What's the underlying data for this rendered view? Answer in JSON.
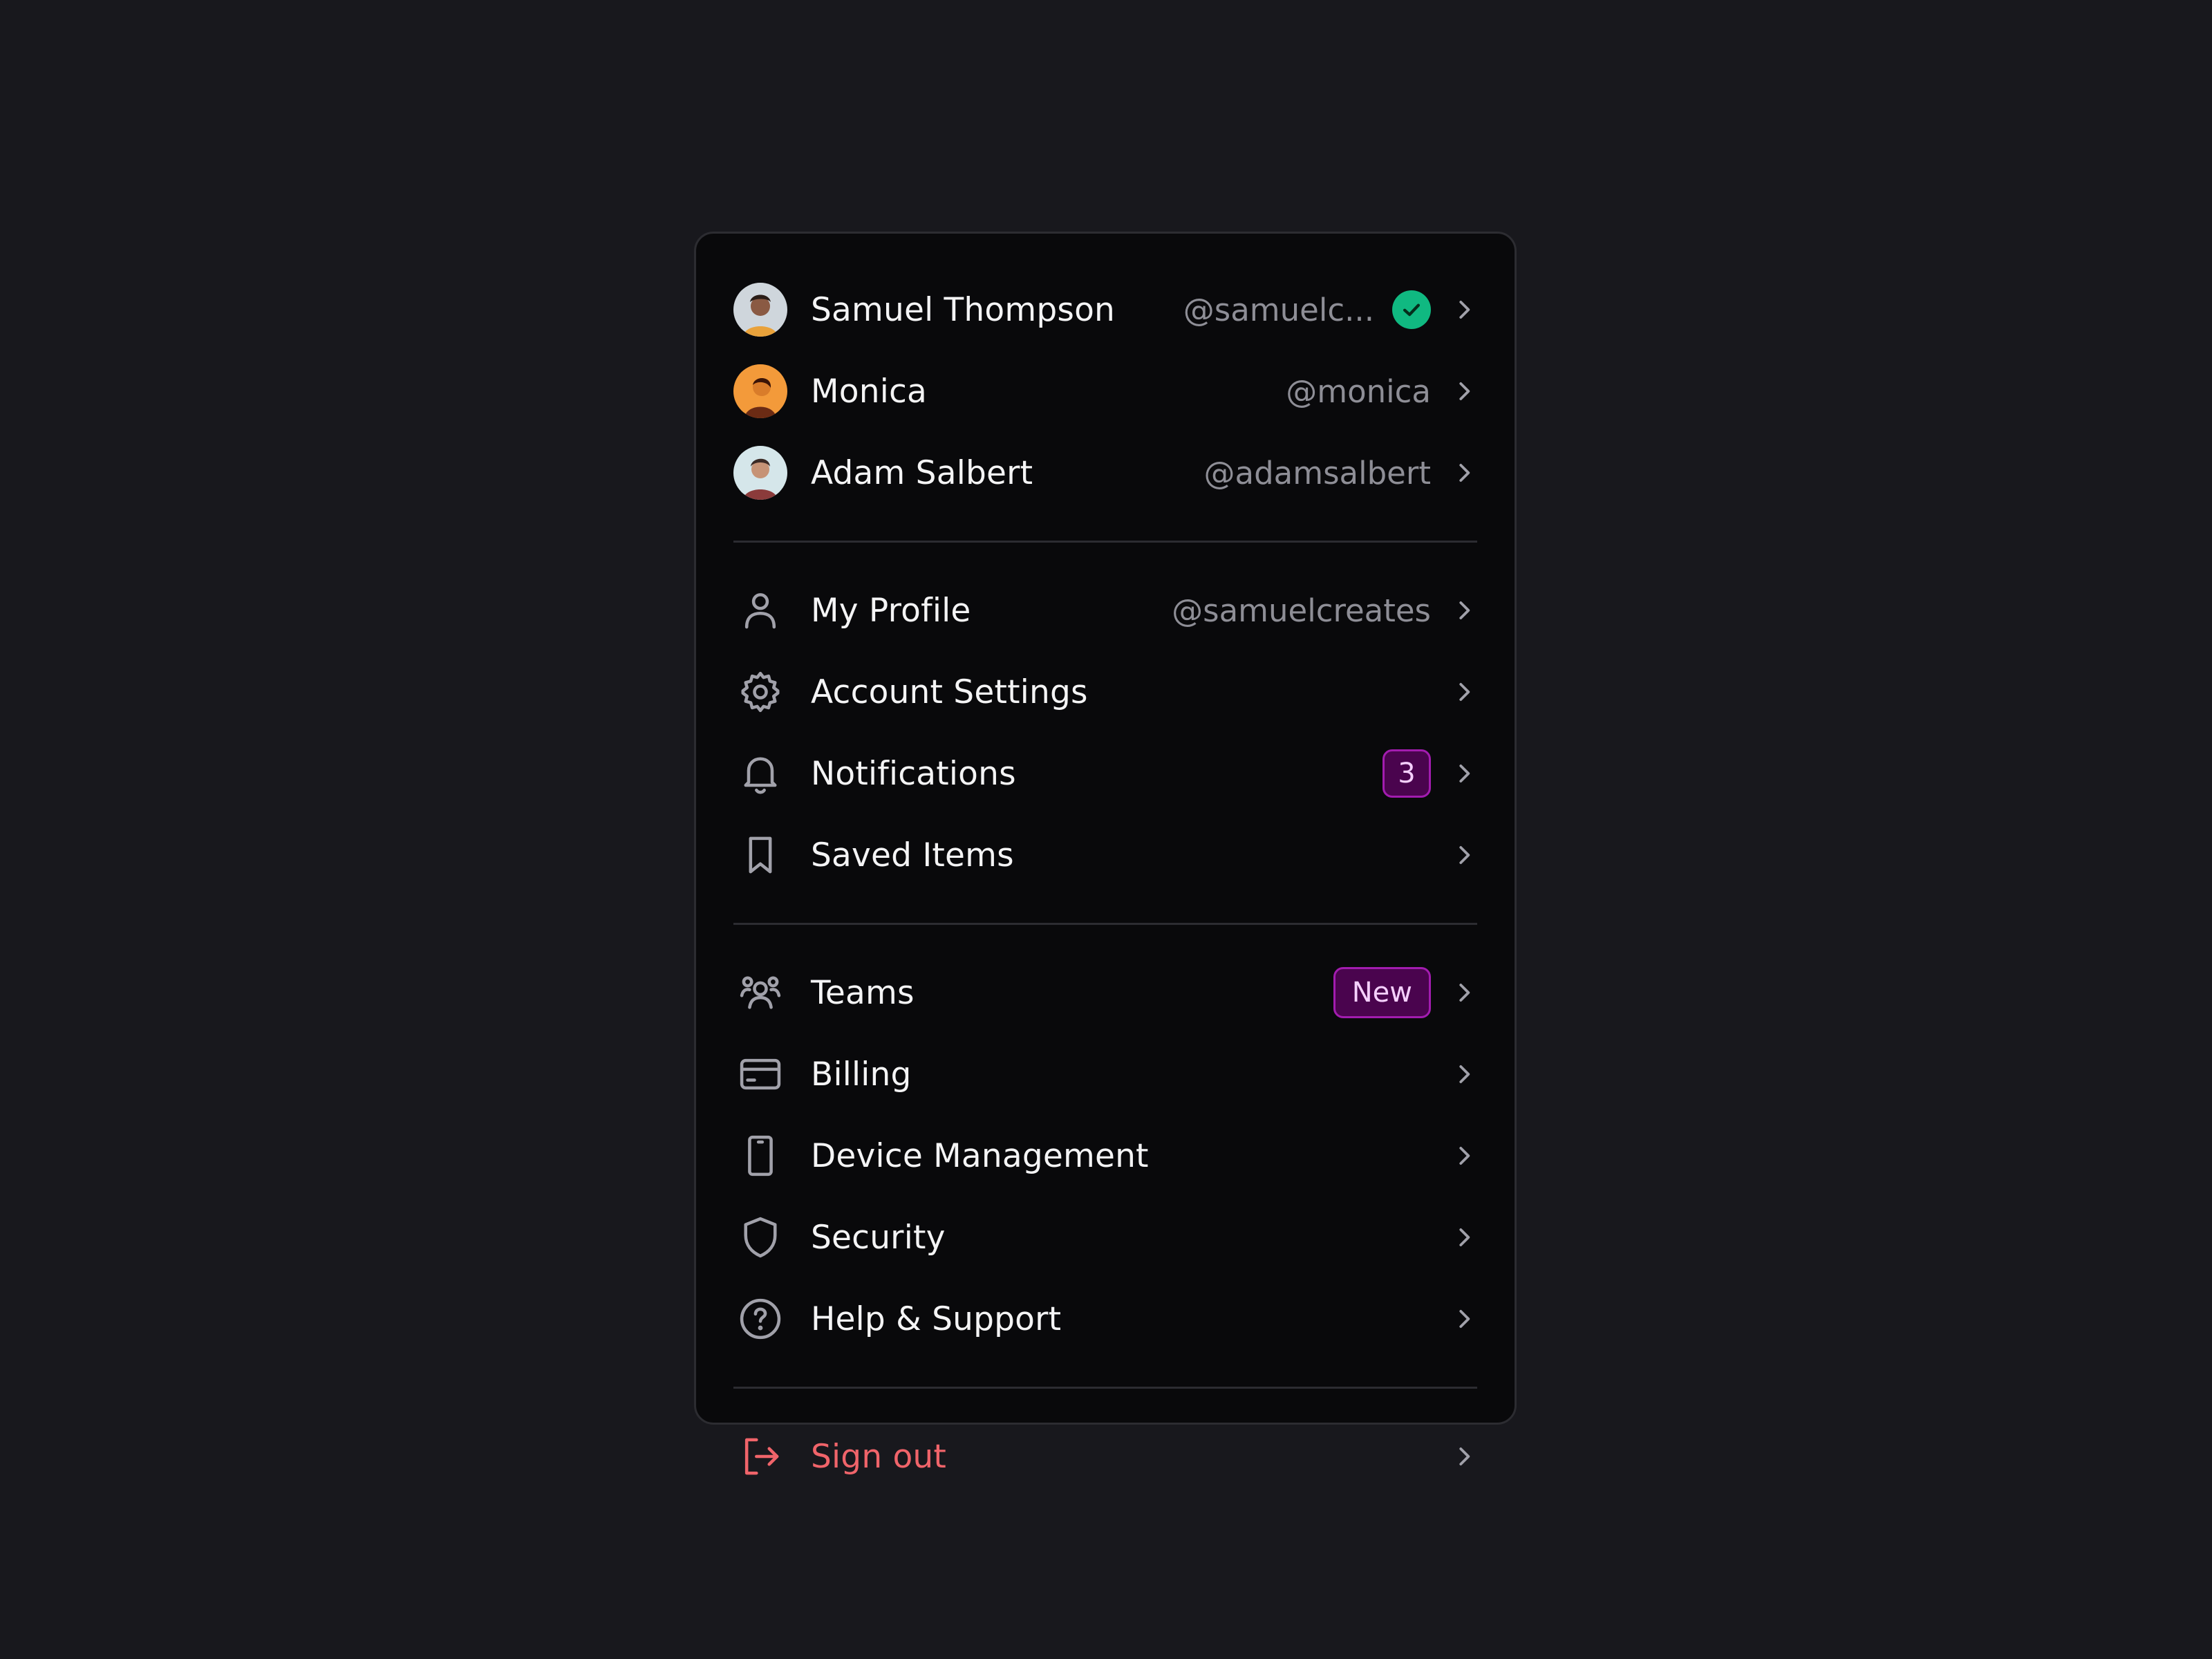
{
  "accounts": [
    {
      "name": "Samuel Thompson",
      "handle": "@samuelc...",
      "verified": true,
      "avatar_colors": [
        "#cfd6dc",
        "#e9a23b",
        "#2a1d17"
      ]
    },
    {
      "name": "Monica",
      "handle": "@monica",
      "verified": false,
      "avatar_colors": [
        "#f39a3a",
        "#6b2b14",
        "#d97c2a"
      ]
    },
    {
      "name": "Adam Salbert",
      "handle": "@adamsalbert",
      "verified": false,
      "avatar_colors": [
        "#d5e6ea",
        "#3b2a25",
        "#8b3b3b"
      ]
    }
  ],
  "profile_section": [
    {
      "label": "My Profile",
      "detail": "@samuelcreates",
      "icon": "user-icon"
    },
    {
      "label": "Account Settings",
      "icon": "gear-icon"
    },
    {
      "label": "Notifications",
      "badge": "3",
      "icon": "bell-icon"
    },
    {
      "label": "Saved Items",
      "icon": "bookmark-icon"
    }
  ],
  "workspace_section": [
    {
      "label": "Teams",
      "badge": "New",
      "icon": "users-icon"
    },
    {
      "label": "Billing",
      "icon": "credit-card-icon"
    },
    {
      "label": "Device Management",
      "icon": "smartphone-icon"
    },
    {
      "label": "Security",
      "icon": "shield-icon"
    },
    {
      "label": "Help & Support",
      "icon": "help-circle-icon"
    }
  ],
  "signout": {
    "label": "Sign out",
    "icon": "log-out-icon"
  },
  "colors": {
    "background": "#18181d",
    "panel": "#09090b",
    "text": "#f4f4f5",
    "muted": "#8e8e96",
    "verified": "#10b981",
    "badge_bg": "#4a044e",
    "badge_border": "#a21caf",
    "danger": "#f0646a"
  }
}
